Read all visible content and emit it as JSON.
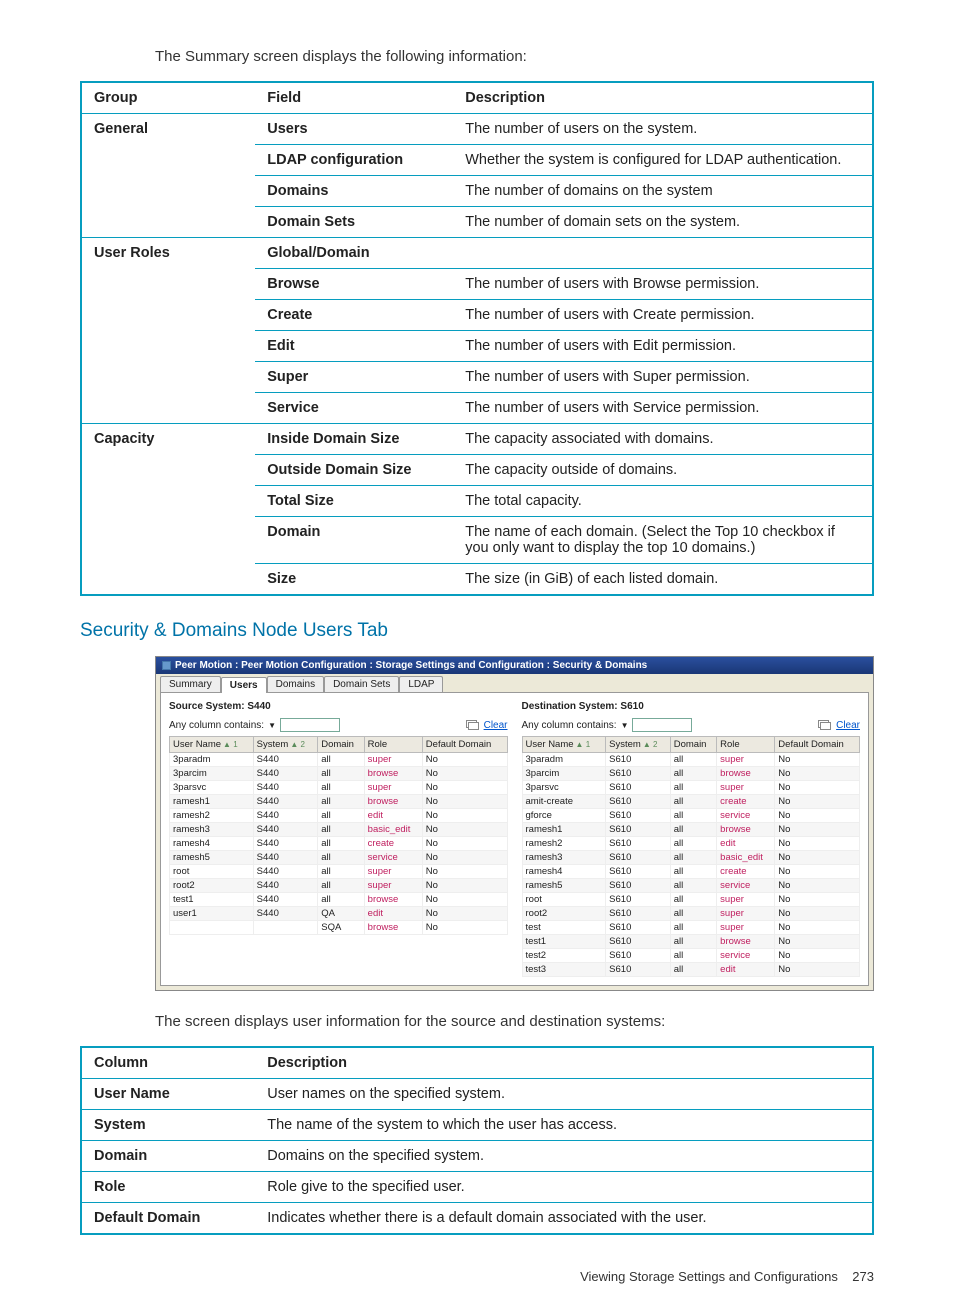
{
  "intro": "The Summary screen displays the following information:",
  "table1": {
    "headers": [
      "Group",
      "Field",
      "Description"
    ],
    "rows": [
      {
        "group": "General",
        "field": "Users",
        "desc": "The number of users on the system."
      },
      {
        "group": "",
        "field": "LDAP configuration",
        "desc": "Whether the system is configured for LDAP authentication."
      },
      {
        "group": "",
        "field": "Domains",
        "desc": "The number of domains on the system"
      },
      {
        "group": "",
        "field": "Domain Sets",
        "desc": "The number of domain sets on the system."
      },
      {
        "group": "User Roles",
        "field": "Global/Domain",
        "desc": ""
      },
      {
        "group": "",
        "field": "Browse",
        "desc": "The number of users with Browse permission."
      },
      {
        "group": "",
        "field": "Create",
        "desc": "The number of users with Create permission."
      },
      {
        "group": "",
        "field": "Edit",
        "desc": "The number of users with Edit permission."
      },
      {
        "group": "",
        "field": "Super",
        "desc": "The number of users with Super permission."
      },
      {
        "group": "",
        "field": "Service",
        "desc": "The number of users with Service permission."
      },
      {
        "group": "Capacity",
        "field": "Inside Domain Size",
        "desc": "The capacity associated with domains."
      },
      {
        "group": "",
        "field": "Outside Domain Size",
        "desc": "The capacity outside of domains."
      },
      {
        "group": "",
        "field": "Total Size",
        "desc": "The total capacity."
      },
      {
        "group": "",
        "field": "Domain",
        "desc": "The name of each domain. (Select the Top 10 checkbox if you only want to display the top 10 domains.)"
      },
      {
        "group": "",
        "field": "Size",
        "desc": "The size (in GiB) of each listed domain."
      }
    ]
  },
  "section_heading": "Security & Domains Node Users Tab",
  "app": {
    "title": "Peer Motion : Peer Motion Configuration : Storage Settings and Configuration : Security & Domains",
    "tabs": [
      "Summary",
      "Users",
      "Domains",
      "Domain Sets",
      "LDAP"
    ],
    "active_tab": "Users",
    "filter_label": "Any column contains:",
    "clear": "Clear",
    "source": {
      "title": "Source System: S440",
      "columns": [
        "User Name",
        "System",
        "Domain",
        "Role",
        "Default Domain"
      ],
      "sort1": "▲ 1",
      "sort2": "▲ 2",
      "rows": [
        [
          "3paradm",
          "S440",
          "all",
          "super",
          "No"
        ],
        [
          "3parcim",
          "S440",
          "all",
          "browse",
          "No"
        ],
        [
          "3parsvc",
          "S440",
          "all",
          "super",
          "No"
        ],
        [
          "ramesh1",
          "S440",
          "all",
          "browse",
          "No"
        ],
        [
          "ramesh2",
          "S440",
          "all",
          "edit",
          "No"
        ],
        [
          "ramesh3",
          "S440",
          "all",
          "basic_edit",
          "No"
        ],
        [
          "ramesh4",
          "S440",
          "all",
          "create",
          "No"
        ],
        [
          "ramesh5",
          "S440",
          "all",
          "service",
          "No"
        ],
        [
          "root",
          "S440",
          "all",
          "super",
          "No"
        ],
        [
          "root2",
          "S440",
          "all",
          "super",
          "No"
        ],
        [
          "test1",
          "S440",
          "all",
          "browse",
          "No"
        ],
        [
          "user1",
          "S440",
          "QA",
          "edit",
          "No"
        ],
        [
          "",
          "",
          "SQA",
          "browse",
          "No"
        ]
      ]
    },
    "dest": {
      "title": "Destination System: S610",
      "columns": [
        "User Name",
        "System",
        "Domain",
        "Role",
        "Default Domain"
      ],
      "sort1": "▲ 1",
      "sort2": "▲ 2",
      "rows": [
        [
          "3paradm",
          "S610",
          "all",
          "super",
          "No"
        ],
        [
          "3parcim",
          "S610",
          "all",
          "browse",
          "No"
        ],
        [
          "3parsvc",
          "S610",
          "all",
          "super",
          "No"
        ],
        [
          "amit-create",
          "S610",
          "all",
          "create",
          "No"
        ],
        [
          "gforce",
          "S610",
          "all",
          "service",
          "No"
        ],
        [
          "ramesh1",
          "S610",
          "all",
          "browse",
          "No"
        ],
        [
          "ramesh2",
          "S610",
          "all",
          "edit",
          "No"
        ],
        [
          "ramesh3",
          "S610",
          "all",
          "basic_edit",
          "No"
        ],
        [
          "ramesh4",
          "S610",
          "all",
          "create",
          "No"
        ],
        [
          "ramesh5",
          "S610",
          "all",
          "service",
          "No"
        ],
        [
          "root",
          "S610",
          "all",
          "super",
          "No"
        ],
        [
          "root2",
          "S610",
          "all",
          "super",
          "No"
        ],
        [
          "test",
          "S610",
          "all",
          "super",
          "No"
        ],
        [
          "test1",
          "S610",
          "all",
          "browse",
          "No"
        ],
        [
          "test2",
          "S610",
          "all",
          "service",
          "No"
        ],
        [
          "test3",
          "S610",
          "all",
          "edit",
          "No"
        ]
      ]
    }
  },
  "below_app": "The screen displays user information for the source and destination systems:",
  "table2": {
    "headers": [
      "Column",
      "Description"
    ],
    "rows": [
      [
        "User Name",
        "User names on the specified system."
      ],
      [
        "System",
        "The name of the system to which the user has access."
      ],
      [
        "Domain",
        "Domains on the specified system."
      ],
      [
        "Role",
        "Role give to the specified user."
      ],
      [
        "Default Domain",
        "Indicates whether there is a default domain associated with the user."
      ]
    ]
  },
  "footer_text": "Viewing Storage Settings and Configurations",
  "footer_page": "273"
}
